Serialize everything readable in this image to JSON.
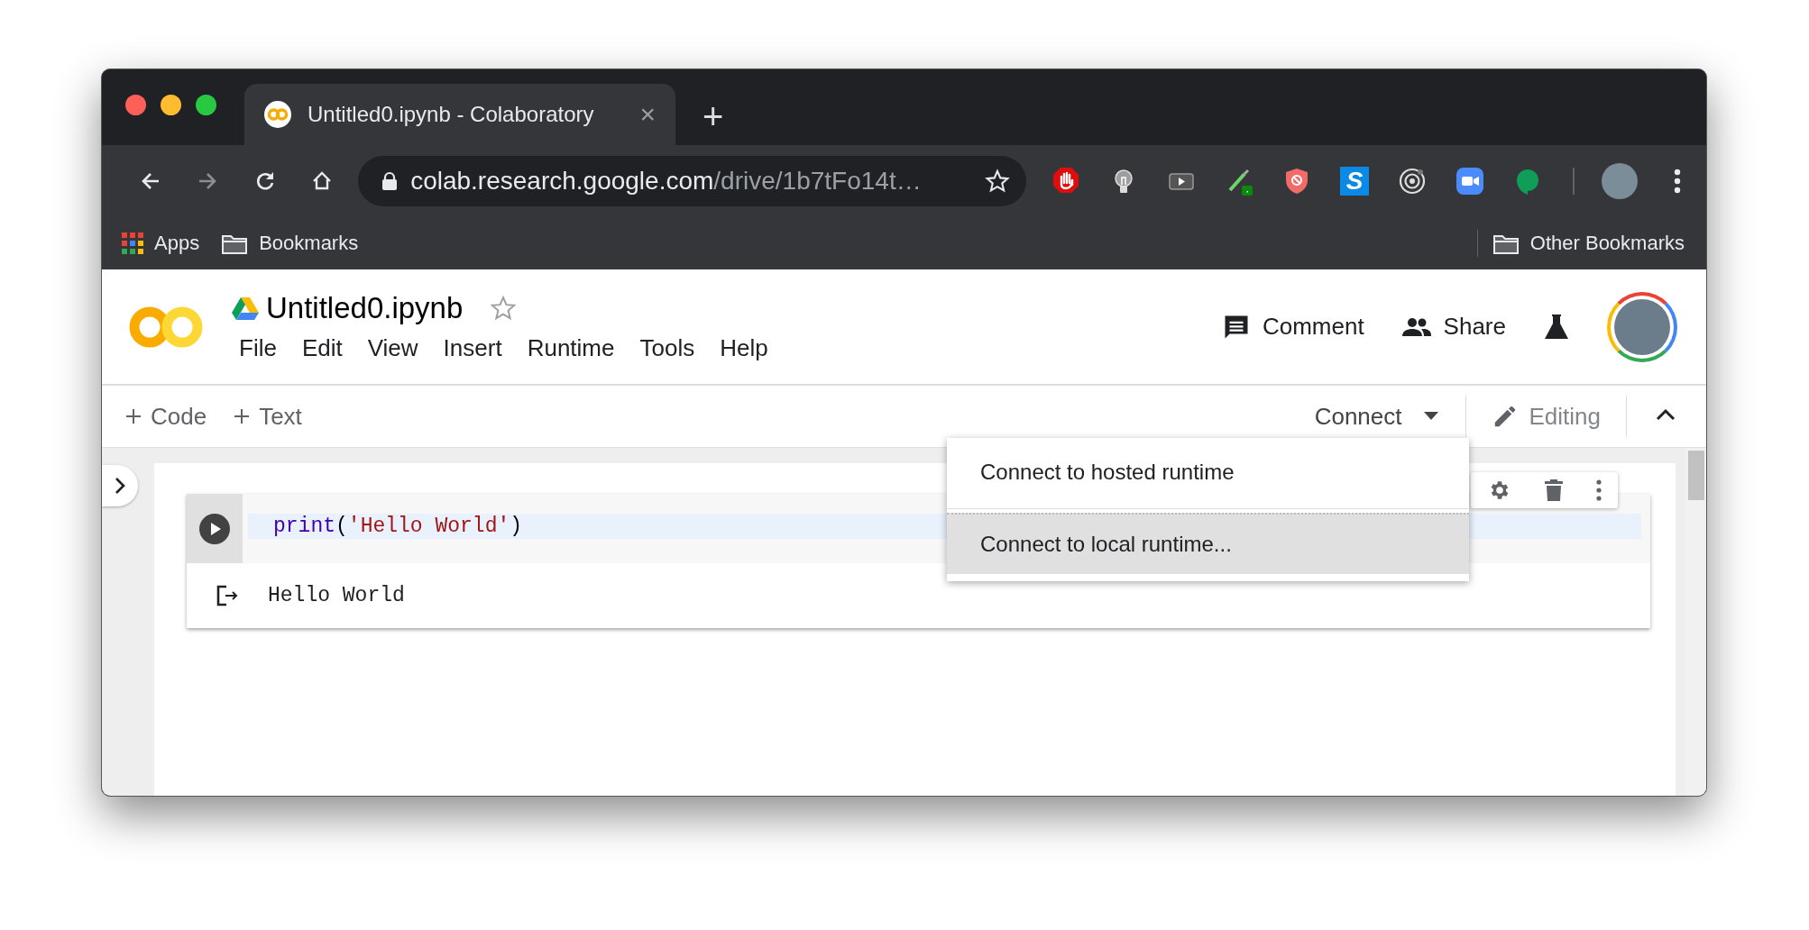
{
  "browser": {
    "tab": {
      "title": "Untitled0.ipynb - Colaboratory",
      "close": "×"
    },
    "new_tab": "+",
    "address": {
      "host": "colab.research.google.com",
      "path": "/drive/1b7tFo14t…"
    },
    "extensions": [
      {
        "kind": "stop-hand"
      },
      {
        "kind": "bulb"
      },
      {
        "kind": "video"
      },
      {
        "kind": "pen"
      },
      {
        "kind": "shield"
      },
      {
        "kind": "letter",
        "label": "S"
      },
      {
        "kind": "target"
      },
      {
        "kind": "camera"
      },
      {
        "kind": "chat"
      }
    ],
    "bookmarks": [
      {
        "kind": "apps",
        "label": "Apps"
      },
      {
        "kind": "folder",
        "label": "Bookmarks"
      }
    ],
    "other_bookmarks": "Other Bookmarks"
  },
  "notebook": {
    "title": "Untitled0.ipynb",
    "menus": [
      "File",
      "Edit",
      "View",
      "Insert",
      "Runtime",
      "Tools",
      "Help"
    ],
    "actions": [
      {
        "kind": "comment",
        "label": "Comment"
      },
      {
        "kind": "share",
        "label": "Share"
      }
    ],
    "toolbar": {
      "add": [
        "Code",
        "Text"
      ],
      "connect": "Connect",
      "mode": "Editing"
    },
    "cell": {
      "code": [
        {
          "kind": "builtin",
          "text": "print"
        },
        {
          "kind": "punct",
          "text": "("
        },
        {
          "kind": "string",
          "text": "'Hello World'"
        },
        {
          "kind": "punct",
          "text": ")"
        }
      ],
      "output": "Hello World"
    },
    "connect_menu": [
      {
        "label": "Connect to hosted runtime",
        "selected": false
      },
      {
        "label": "Connect to local runtime...",
        "selected": true
      }
    ]
  }
}
